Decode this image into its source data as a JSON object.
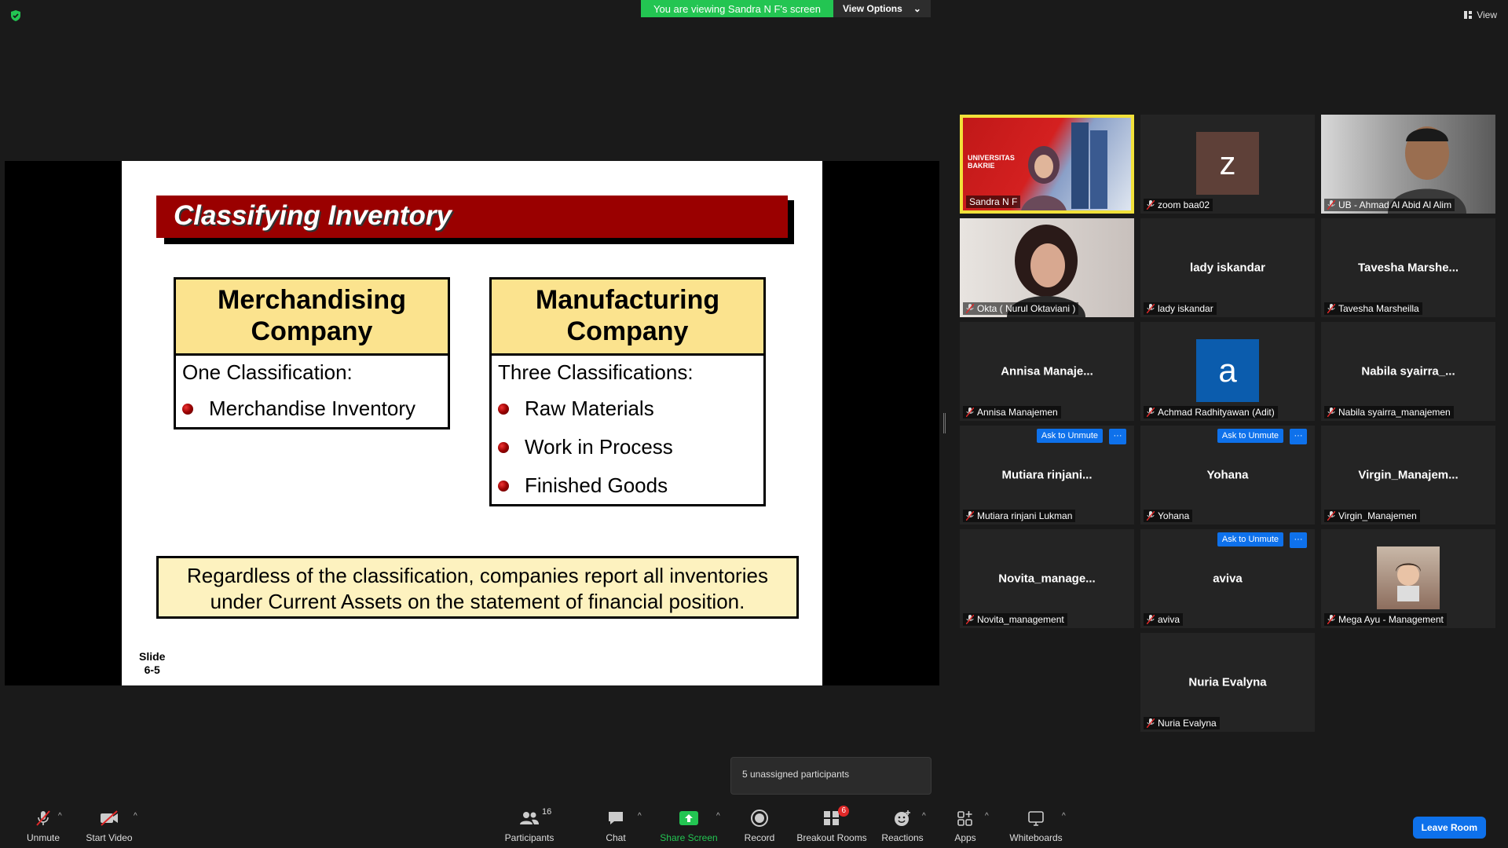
{
  "banner": {
    "viewing": "You are viewing Sandra N F's screen",
    "view_options": "View Options"
  },
  "top_right": {
    "view_label": "View"
  },
  "slide": {
    "title": "Classifying Inventory",
    "left_box": {
      "heading_line1": "Merchandising",
      "heading_line2": "Company",
      "sub": "One Classification:",
      "items": [
        "Merchandise Inventory"
      ]
    },
    "right_box": {
      "heading_line1": "Manufacturing",
      "heading_line2": "Company",
      "sub": "Three Classifications:",
      "items": [
        "Raw Materials",
        "Work in Process",
        "Finished Goods"
      ]
    },
    "note_line1": "Regardless of the classification, companies report all inventories",
    "note_line2": "under Current Assets on the statement of financial position.",
    "slide_no_line1": "Slide",
    "slide_no_line2": "6-5"
  },
  "participants": [
    {
      "name": "Sandra N F",
      "type": "video",
      "active": true,
      "muted": false,
      "video_text_1": "UNIVERSITAS",
      "video_text_2": "BAKRIE"
    },
    {
      "name": "zoom baa02",
      "type": "avatar",
      "letter": "z",
      "color": "#5e4038",
      "muted": true
    },
    {
      "name": "UB - Ahmad Al Abid Al Alim",
      "type": "video",
      "muted": true
    },
    {
      "name": "Okta ( Nurul Oktaviani )",
      "type": "video",
      "muted": true
    },
    {
      "name": "lady iskandar",
      "type": "text",
      "display": "lady iskandar",
      "muted": true
    },
    {
      "name": "Tavesha Marsheilla",
      "type": "text",
      "display": "Tavesha Marshe...",
      "muted": true
    },
    {
      "name": "Annisa Manajemen",
      "type": "text",
      "display": "Annisa Manaje...",
      "muted": true
    },
    {
      "name": "Achmad Radhityawan (Adit)",
      "type": "avatar",
      "letter": "a",
      "color": "#0b5cad",
      "muted": true
    },
    {
      "name": "Nabila syairra_manajemen",
      "type": "text",
      "display": "Nabila syairra_...",
      "muted": true
    },
    {
      "name": "Mutiara rinjani Lukman",
      "type": "text",
      "display": "Mutiara rinjani...",
      "muted": true,
      "ask": true
    },
    {
      "name": "Yohana",
      "type": "text",
      "display": "Yohana",
      "muted": true,
      "ask": true
    },
    {
      "name": "Virgin_Manajemen",
      "type": "text",
      "display": "Virgin_Manajem...",
      "muted": true
    },
    {
      "name": "Novita_management",
      "type": "text",
      "display": "Novita_manage...",
      "muted": true
    },
    {
      "name": "aviva",
      "type": "text",
      "display": "aviva",
      "muted": true,
      "ask": true
    },
    {
      "name": "Mega Ayu - Management",
      "type": "photo",
      "muted": true
    },
    {
      "name": "Nuria Evalyna",
      "type": "text",
      "display": "Nuria Evalyna",
      "muted": true
    }
  ],
  "ask_to_unmute": "Ask to Unmute",
  "more": "···",
  "popup": {
    "text": "5 unassigned participants"
  },
  "toolbar": {
    "unmute": "Unmute",
    "start_video": "Start Video",
    "participants": "Participants",
    "participants_count": "16",
    "chat": "Chat",
    "share_screen": "Share Screen",
    "record": "Record",
    "breakout_rooms": "Breakout Rooms",
    "breakout_count": "6",
    "reactions": "Reactions",
    "apps": "Apps",
    "whiteboards": "Whiteboards",
    "leave": "Leave Room"
  },
  "colors": {
    "green": "#23c552",
    "blue": "#0e71eb",
    "active_border": "#f1e13a",
    "slide_title_bg": "#9a0000",
    "box_head_bg": "#fbe38e"
  }
}
